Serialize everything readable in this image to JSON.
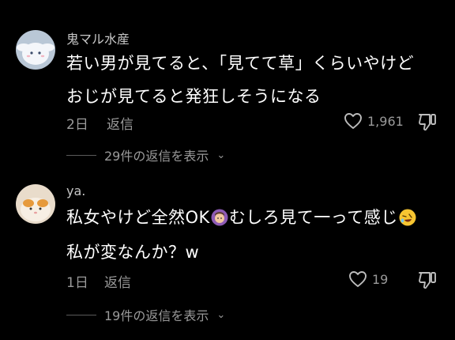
{
  "comments": [
    {
      "username": "鬼マル水産",
      "lines": [
        "若い男が見てると、「見てて草」くらいやけど",
        "おじが見てると発狂しそうになる"
      ],
      "date": "2日",
      "reply_label": "返信",
      "like_count": "1,961",
      "view_replies": "29件の返信を表示",
      "avatar_icon": "cinnamoroll-avatar-icon"
    },
    {
      "username": "ya.",
      "line1_a": "私女やけど全然OK",
      "line1_b": "むしろ見て一って感じ",
      "line2": "私が変なんか？w",
      "date": "1日",
      "reply_label": "返信",
      "like_count": "19",
      "view_replies": "19件の返信を表示",
      "avatar_icon": "cat-avatar-icon",
      "emojis": [
        "woman-gesturing-ok-emoji",
        "rolling-on-floor-laughing-emoji"
      ]
    }
  ],
  "colors": {
    "background": "#000000",
    "text": "#ffffff",
    "muted": "#9a9a9a"
  }
}
